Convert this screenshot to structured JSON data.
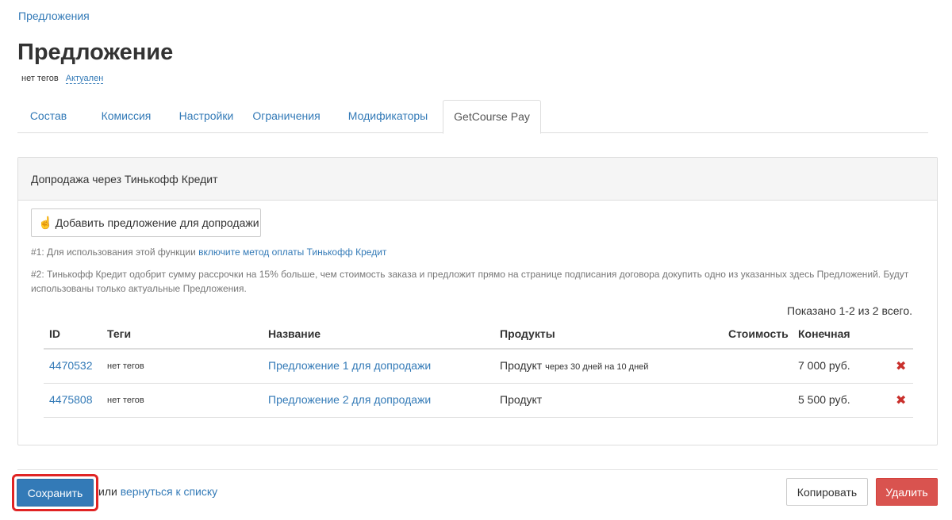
{
  "breadcrumb": {
    "label": "Предложения"
  },
  "title": "Предложение",
  "meta": {
    "tags": "нет тегов",
    "status": "Актуален"
  },
  "tabs": [
    {
      "label": "Состав"
    },
    {
      "label": "Комиссия"
    },
    {
      "label": "Настройки"
    },
    {
      "label": "Ограничения"
    },
    {
      "label": "Модификаторы"
    },
    {
      "label": "GetCourse Pay",
      "active": true
    }
  ],
  "panel": {
    "heading": "Допродажа через Тинькофф Кредит",
    "add_button": "Добавить предложение для допродажи",
    "add_button_icon": "hand-pointer-icon",
    "note1_prefix": "#1: Для использования этой функции ",
    "note1_link": "включите метод оплаты Тинькофф Кредит",
    "note2": "#2: Тинькофф Кредит одобрит сумму рассрочки на 15% больше, чем стоимость заказа и предложит прямо на странице подписания договора докупить одно из указанных здесь Предложений. Будут использованы только актуальные Предложения.",
    "summary": "Показано 1-2 из 2 всего."
  },
  "table": {
    "headers": {
      "id": "ID",
      "tags": "Теги",
      "name": "Название",
      "products": "Продукты",
      "cost": "Стоимость",
      "final": "Конечная"
    },
    "rows": [
      {
        "id": "4470532",
        "tags": "нет тегов",
        "name": "Предложение 1 для допродажи",
        "product": "Продукт",
        "product_note": "через 30 дней на 10 дней",
        "final": "7 000 руб."
      },
      {
        "id": "4475808",
        "tags": "нет тегов",
        "name": "Предложение 2 для допродажи",
        "product": "Продукт",
        "product_note": "",
        "final": "5 500 руб."
      }
    ]
  },
  "footer": {
    "save": "Сохранить",
    "or": "или ",
    "back": "вернуться к списку",
    "copy": "Копировать",
    "delete": "Удалить"
  },
  "colors": {
    "accent": "#337ab7",
    "danger": "#d9534f",
    "highlight": "#e02424"
  }
}
